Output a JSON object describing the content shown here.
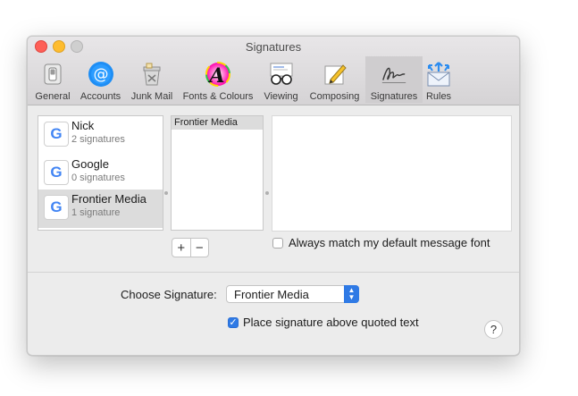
{
  "window": {
    "title": "Signatures"
  },
  "toolbar": {
    "items": [
      {
        "label": "General",
        "icon": "general-switch-icon"
      },
      {
        "label": "Accounts",
        "icon": "at-sign-icon"
      },
      {
        "label": "Junk Mail",
        "icon": "junk-bin-icon"
      },
      {
        "label": "Fonts & Colours",
        "icon": "fonts-colours-icon"
      },
      {
        "label": "Viewing",
        "icon": "glasses-icon"
      },
      {
        "label": "Composing",
        "icon": "pencil-paper-icon"
      },
      {
        "label": "Signatures",
        "icon": "signature-icon",
        "active": true
      },
      {
        "label": "Rules",
        "icon": "rules-envelope-icon"
      }
    ]
  },
  "accounts": [
    {
      "name": "Nick",
      "count": "2 signatures"
    },
    {
      "name": "Google",
      "count": "0 signatures"
    },
    {
      "name": "Frontier Media",
      "count": "1 signature",
      "selected": true
    }
  ],
  "signatures": {
    "items": [
      "Frontier Media"
    ]
  },
  "controls": {
    "add": "+",
    "remove": "−",
    "match_font_label": "Always match my default message font",
    "match_font_checked": false,
    "choose_label": "Choose Signature:",
    "choose_value": "Frontier Media",
    "place_above_label": "Place signature above quoted text",
    "place_above_checked": true,
    "help": "?"
  },
  "colors": {
    "accent": "#2f7ae5",
    "google_g": "#4285f4"
  }
}
